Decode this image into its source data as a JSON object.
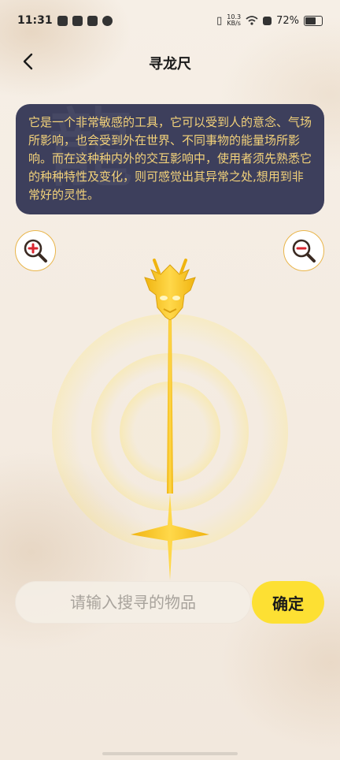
{
  "status_bar": {
    "time": "11:31",
    "net_speed_value": "10.3",
    "net_speed_unit": "KB/s",
    "battery": "72%"
  },
  "header": {
    "title": "寻龙尺"
  },
  "description": {
    "text": "它是一个非常敏感的工具，它可以受到人的意念、气场所影响，也会受到外在世界、不同事物的能量场所影响。而在这种种内外的交互影响中，使用者须先熟悉它的种种特性及变化，则可感觉出其异常之处,想用到非常好的灵性。"
  },
  "search": {
    "placeholder": "请输入搜寻的物品",
    "value": ""
  },
  "confirm": {
    "label": "确定"
  },
  "colors": {
    "accent_yellow": "#fde033",
    "card_bg": "#3d3f5c",
    "card_text": "#f3d27a",
    "rod_gold": "#f6c51c"
  },
  "icons": [
    "back-icon",
    "zoom-in-icon",
    "zoom-out-icon",
    "dragon-rod"
  ]
}
